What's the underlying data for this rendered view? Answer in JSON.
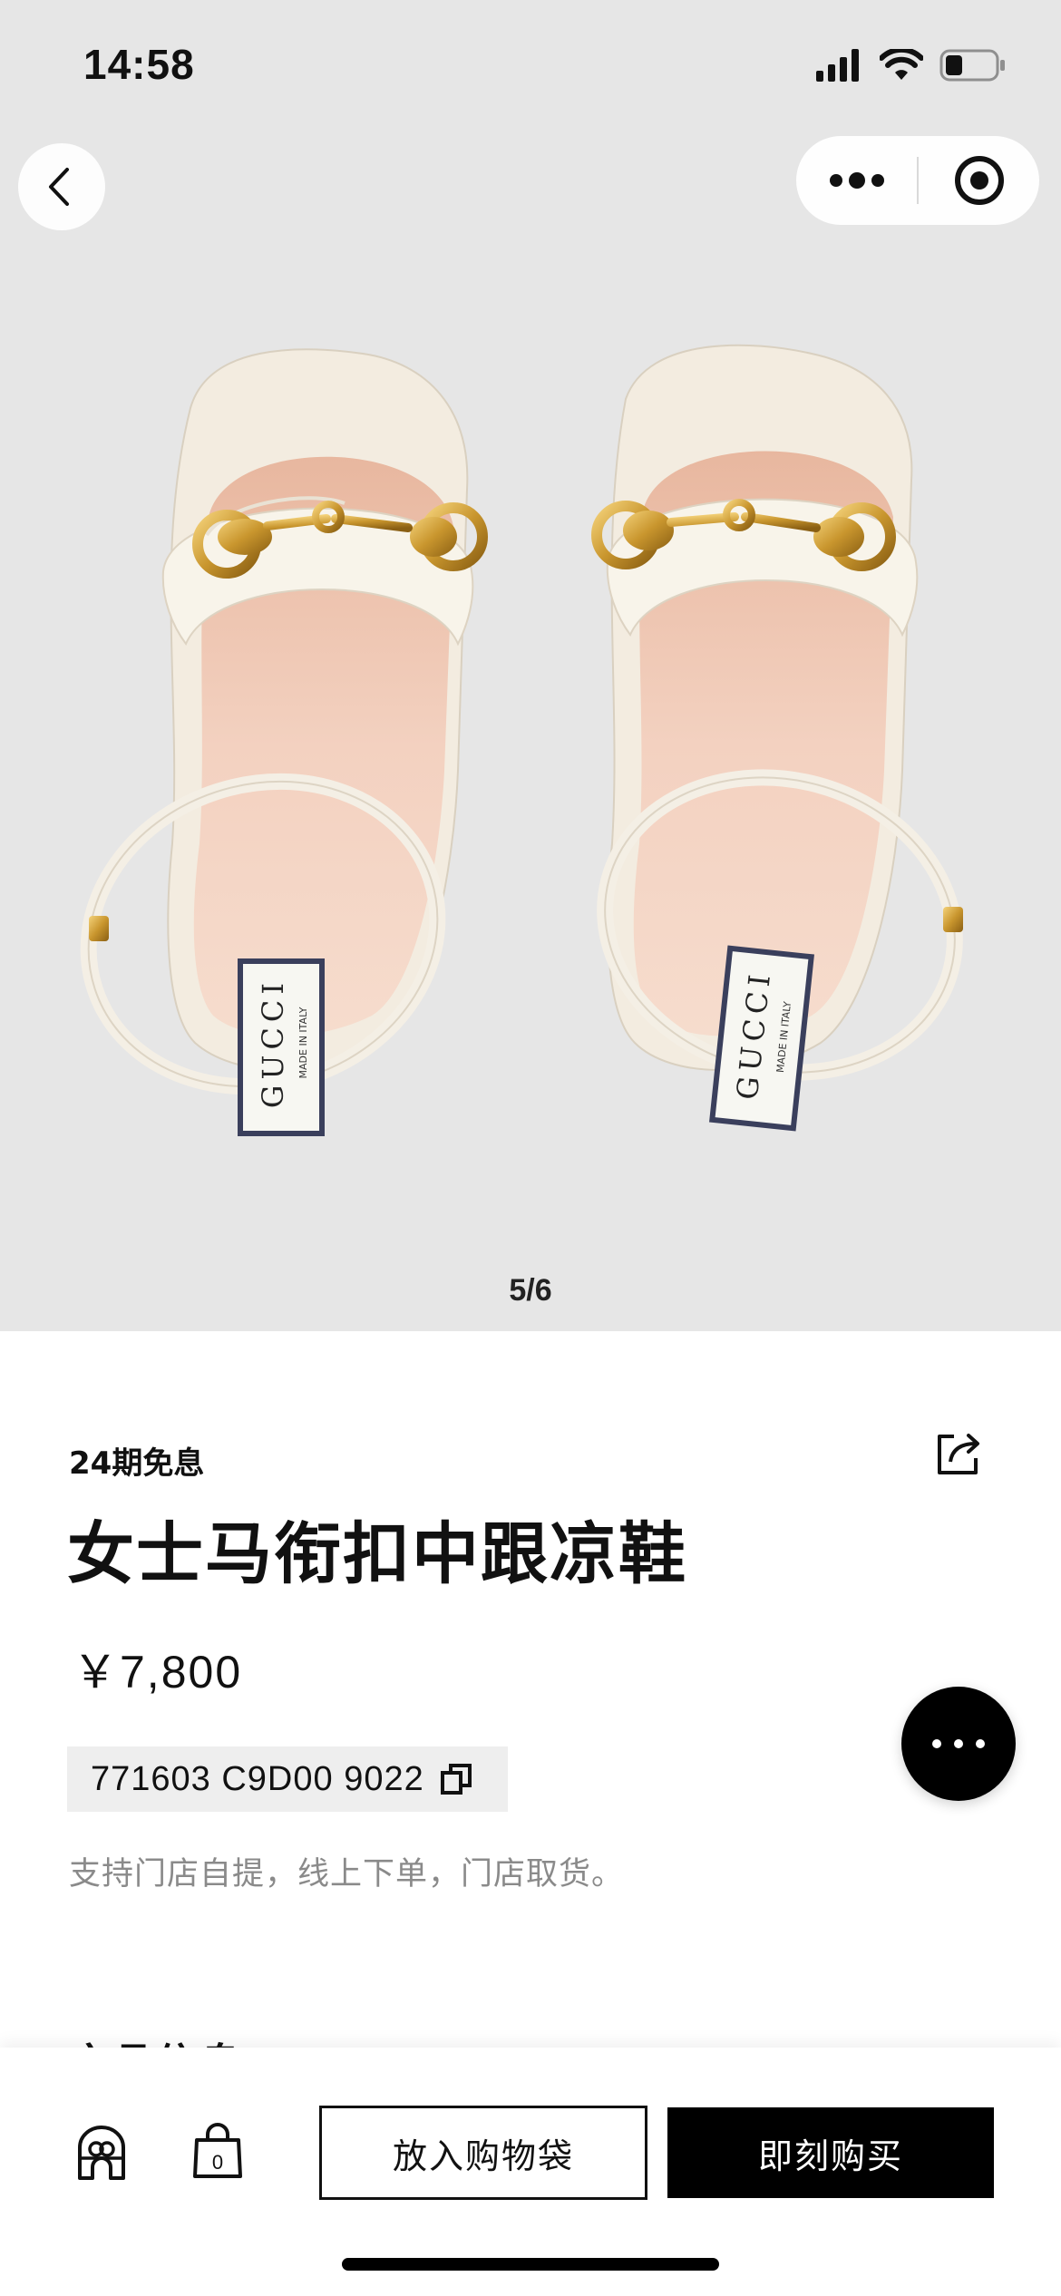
{
  "status_bar": {
    "time": "14:58",
    "icons": [
      "cellular-signal-icon",
      "wifi-icon",
      "battery-icon"
    ]
  },
  "nav": {
    "back_icon": "chevron-left-icon",
    "more_icon": "more-dots-icon",
    "close_icon": "target-close-icon"
  },
  "gallery": {
    "counter": "5/6",
    "image": "white-horsebit-ankle-strap-sandals",
    "insole_brand": "GUCCI",
    "insole_text": "MADE IN ITALY"
  },
  "product": {
    "installment": "24期免息",
    "title": "女士马衔扣中跟凉鞋",
    "price": "￥7,800",
    "sku": "771603 C9D00 9022",
    "pickup_note": "支持门店自提，线上下单，门店取货。",
    "section_peek": "产品信息",
    "share_icon": "share-icon",
    "copy_icon": "copy-icon"
  },
  "chat": {
    "icon": "chat-dots-icon"
  },
  "bottom_bar": {
    "store_icon": "store-icon",
    "bag_icon": "shopping-bag-icon",
    "bag_count": "0",
    "add_to_bag": "放入购物袋",
    "buy_now": "即刻购买"
  },
  "colors": {
    "hero_bg": "#e6e6e6",
    "primary": "#000000",
    "muted_text": "#8a8a8a",
    "chip_bg": "#eeeeee",
    "gold": "#c9962e"
  }
}
